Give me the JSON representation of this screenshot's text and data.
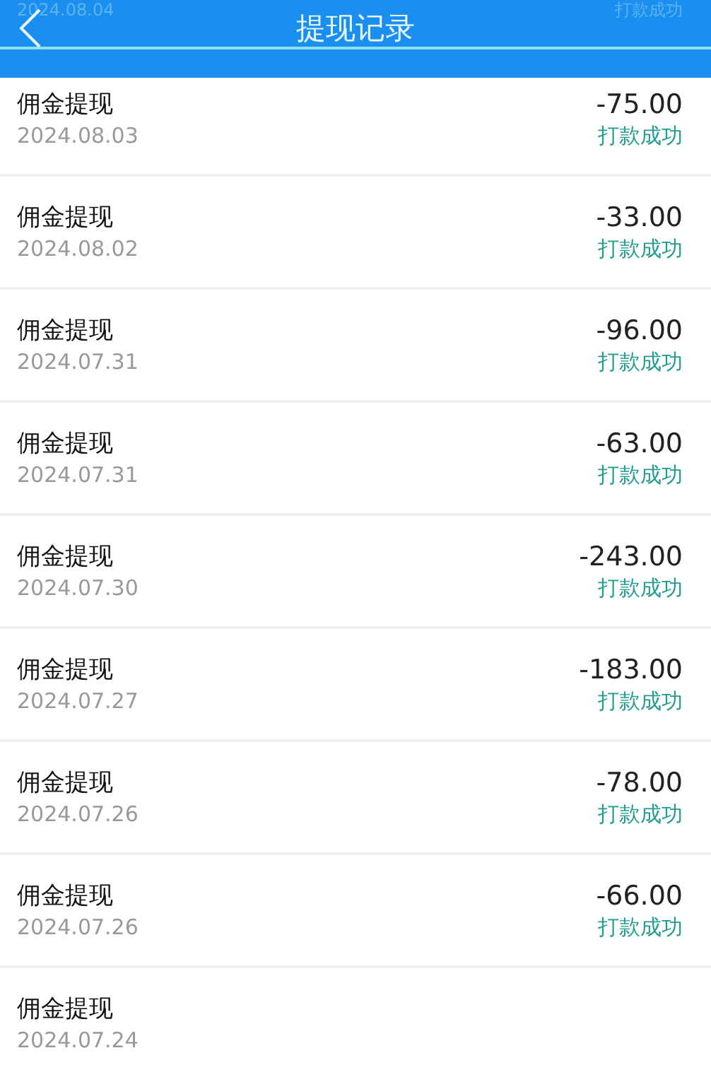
{
  "header": {
    "title": "提现记录",
    "behind_date": "2024.08.04",
    "behind_status": "打款成功"
  },
  "records": [
    {
      "name": "佣金提现",
      "date": "2024.08.03",
      "amount": "-75.00",
      "status": "打款成功"
    },
    {
      "name": "佣金提现",
      "date": "2024.08.02",
      "amount": "-33.00",
      "status": "打款成功"
    },
    {
      "name": "佣金提现",
      "date": "2024.07.31",
      "amount": "-96.00",
      "status": "打款成功"
    },
    {
      "name": "佣金提现",
      "date": "2024.07.31",
      "amount": "-63.00",
      "status": "打款成功"
    },
    {
      "name": "佣金提现",
      "date": "2024.07.30",
      "amount": "-243.00",
      "status": "打款成功"
    },
    {
      "name": "佣金提现",
      "date": "2024.07.27",
      "amount": "-183.00",
      "status": "打款成功"
    },
    {
      "name": "佣金提现",
      "date": "2024.07.26",
      "amount": "-78.00",
      "status": "打款成功"
    },
    {
      "name": "佣金提现",
      "date": "2024.07.26",
      "amount": "-66.00",
      "status": "打款成功"
    },
    {
      "name": "佣金提现",
      "date": "2024.07.24"
    }
  ]
}
